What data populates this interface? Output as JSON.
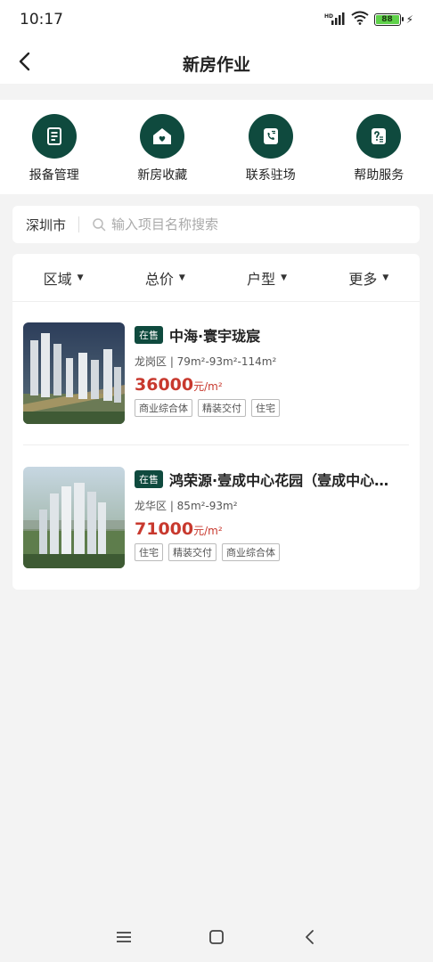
{
  "status_bar": {
    "time": "10:17",
    "network": "HD",
    "battery": "88"
  },
  "nav": {
    "title": "新房作业",
    "back_icon": "back-arrow-icon"
  },
  "quick_actions": [
    {
      "label": "报备管理",
      "icon": "document-icon"
    },
    {
      "label": "新房收藏",
      "icon": "house-heart-icon"
    },
    {
      "label": "联系驻场",
      "icon": "phone-icon"
    },
    {
      "label": "帮助服务",
      "icon": "help-icon"
    }
  ],
  "search": {
    "city": "深圳市",
    "placeholder": "输入项目名称搜索"
  },
  "filters": [
    "区域",
    "总价",
    "户型",
    "更多"
  ],
  "listings": [
    {
      "status": "在售",
      "name": "中海·寰宇珑宸",
      "meta": "龙岗区 | 79m²-93m²-114m²",
      "price": "36000",
      "price_unit": "元/m²",
      "tags": [
        "商业综合体",
        "精装交付",
        "住宅"
      ]
    },
    {
      "status": "在售",
      "name": "鸿荣源·壹成中心花园（壹成中心…",
      "meta": "龙华区 | 85m²-93m²",
      "price": "71000",
      "price_unit": "元/m²",
      "tags": [
        "住宅",
        "精装交付",
        "商业综合体"
      ]
    }
  ],
  "colors": {
    "brand": "#0f4a3e",
    "price": "#c8392e",
    "background": "#f3f3f3"
  }
}
